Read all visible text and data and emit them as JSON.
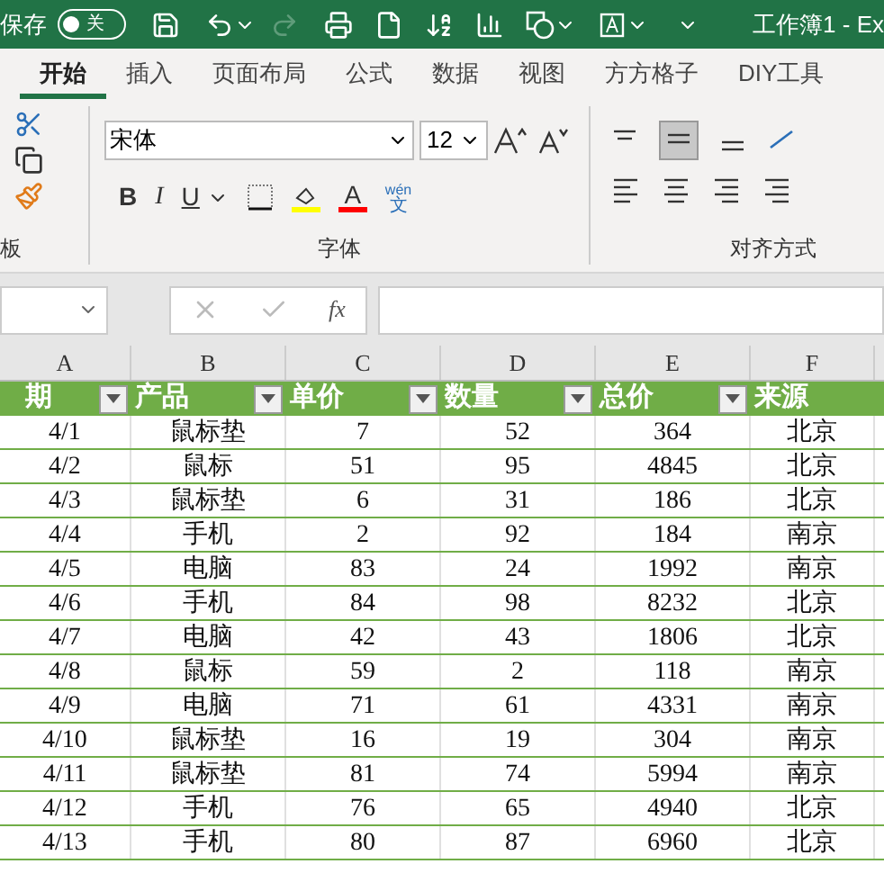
{
  "title_bar": {
    "autosave_label": "保存",
    "autosave": {
      "on": false,
      "label": "关"
    },
    "title": "工作簿1  -  Ex"
  },
  "tabs": [
    {
      "label": "开始",
      "selected": true
    },
    {
      "label": "插入",
      "selected": false
    },
    {
      "label": "页面布局",
      "selected": false
    },
    {
      "label": "公式",
      "selected": false
    },
    {
      "label": "数据",
      "selected": false
    },
    {
      "label": "视图",
      "selected": false
    },
    {
      "label": "方方格子",
      "selected": false
    },
    {
      "label": "DIY工具",
      "selected": false
    }
  ],
  "ribbon": {
    "clipboard_label": "板",
    "font": {
      "name": "宋体",
      "size": "12",
      "bold_letter": "B",
      "italic_letter": "I",
      "underline_letter": "U",
      "font_color_letter": "A",
      "phonetic_top": "wén",
      "phonetic_bottom": "文",
      "label": "字体"
    },
    "alignment": {
      "middle_selected": true,
      "label": "对齐方式"
    }
  },
  "formula_bar": {
    "fx": "fx"
  },
  "columns": [
    "A",
    "B",
    "C",
    "D",
    "E",
    "F"
  ],
  "header": [
    "期",
    "产品",
    "单价",
    "数量",
    "总价",
    "来源"
  ],
  "rows": [
    [
      "4/1",
      "鼠标垫",
      "7",
      "52",
      "364",
      "北京"
    ],
    [
      "4/2",
      "鼠标",
      "51",
      "95",
      "4845",
      "北京"
    ],
    [
      "4/3",
      "鼠标垫",
      "6",
      "31",
      "186",
      "北京"
    ],
    [
      "4/4",
      "手机",
      "2",
      "92",
      "184",
      "南京"
    ],
    [
      "4/5",
      "电脑",
      "83",
      "24",
      "1992",
      "南京"
    ],
    [
      "4/6",
      "手机",
      "84",
      "98",
      "8232",
      "北京"
    ],
    [
      "4/7",
      "电脑",
      "42",
      "43",
      "1806",
      "北京"
    ],
    [
      "4/8",
      "鼠标",
      "59",
      "2",
      "118",
      "南京"
    ],
    [
      "4/9",
      "电脑",
      "71",
      "61",
      "4331",
      "南京"
    ],
    [
      "4/10",
      "鼠标垫",
      "16",
      "19",
      "304",
      "南京"
    ],
    [
      "4/11",
      "鼠标垫",
      "81",
      "74",
      "5994",
      "南京"
    ],
    [
      "4/12",
      "手机",
      "76",
      "65",
      "4940",
      "北京"
    ],
    [
      "4/13",
      "手机",
      "80",
      "87",
      "6960",
      "北京"
    ]
  ]
}
